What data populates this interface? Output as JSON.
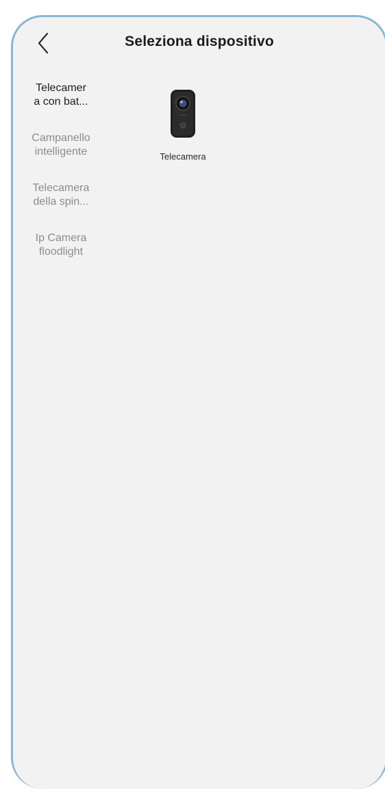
{
  "header": {
    "title": "Seleziona dispositivo",
    "back_icon": "chevron-left-icon"
  },
  "sidebar": {
    "items": [
      {
        "label": "Telecamer\na con bat...",
        "active": true
      },
      {
        "label": "Campanello\nintelligente",
        "active": false
      },
      {
        "label": "Telecamera\ndella spin...",
        "active": false
      },
      {
        "label": "Ip Camera\nfloodlight",
        "active": false
      }
    ]
  },
  "devices": [
    {
      "label": "Telecamera",
      "icon": "battery-camera-icon"
    }
  ],
  "colors": {
    "background": "#f2f2f2",
    "frame_border": "#8ab6d8",
    "active_text": "#1e1e1e",
    "inactive_text": "#8c8c8c"
  }
}
